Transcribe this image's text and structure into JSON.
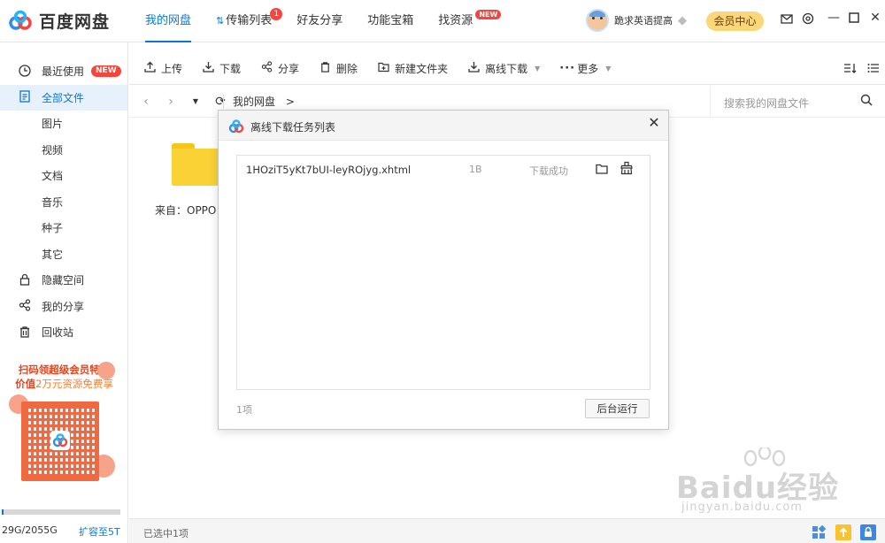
{
  "app": {
    "name": "百度网盘"
  },
  "nav": {
    "tabs": [
      {
        "label": "我的网盘"
      },
      {
        "label": "传输列表",
        "badge": "1"
      },
      {
        "label": "好友分享"
      },
      {
        "label": "功能宝箱"
      },
      {
        "label": "找资源",
        "badge": "NEW"
      }
    ]
  },
  "user": {
    "name": "跪求英语提高",
    "vip_button": "会员中心"
  },
  "sidebar": {
    "items": [
      {
        "label": "最近使用",
        "badge": "NEW",
        "icon": "clock-icon"
      },
      {
        "label": "全部文件",
        "icon": "file-icon"
      },
      {
        "label": "图片"
      },
      {
        "label": "视频"
      },
      {
        "label": "文档"
      },
      {
        "label": "音乐"
      },
      {
        "label": "种子"
      },
      {
        "label": "其它"
      },
      {
        "label": "隐藏空间",
        "icon": "lock-icon"
      },
      {
        "label": "我的分享",
        "icon": "share-icon"
      },
      {
        "label": "回收站",
        "icon": "trash-icon"
      }
    ],
    "promo": {
      "line1": "扫码领超级会员特权",
      "line2_prefix": "价值",
      "line2_highlight": "2万元资源免费享"
    },
    "storage": {
      "text": "29G/2055G",
      "used_fraction": 0.014,
      "expand": "扩容至5T"
    }
  },
  "toolbar": {
    "buttons": [
      {
        "label": "上传",
        "icon": "upload-icon"
      },
      {
        "label": "下载",
        "icon": "download-icon"
      },
      {
        "label": "分享",
        "icon": "share-icon"
      },
      {
        "label": "删除",
        "icon": "trash-icon"
      },
      {
        "label": "新建文件夹",
        "icon": "new-folder-icon"
      },
      {
        "label": "离线下载",
        "icon": "offline-download-icon"
      },
      {
        "label": "更多",
        "icon": "more-icon"
      }
    ]
  },
  "address": {
    "breadcrumb": "我的网盘",
    "separator": ">",
    "search_placeholder": "搜索我的网盘文件"
  },
  "content": {
    "folder_label": "来自：OPPO A"
  },
  "status": {
    "selected_text": "已选中1项"
  },
  "dialog": {
    "title": "离线下载任务列表",
    "tasks": [
      {
        "name": "1HOziT5yKt7bUI-leyROjyg.xhtml",
        "size": "1B",
        "status": "下载成功"
      }
    ],
    "count": "1项",
    "background_button": "后台运行"
  },
  "watermark": {
    "text": "Baidu经验",
    "url": "jingyan.baidu.com"
  },
  "colors": {
    "accent": "#0a78d7",
    "badge_red": "#f5453d",
    "vip_gold": "#fcd77a",
    "folder_yellow": "#fbd235"
  }
}
